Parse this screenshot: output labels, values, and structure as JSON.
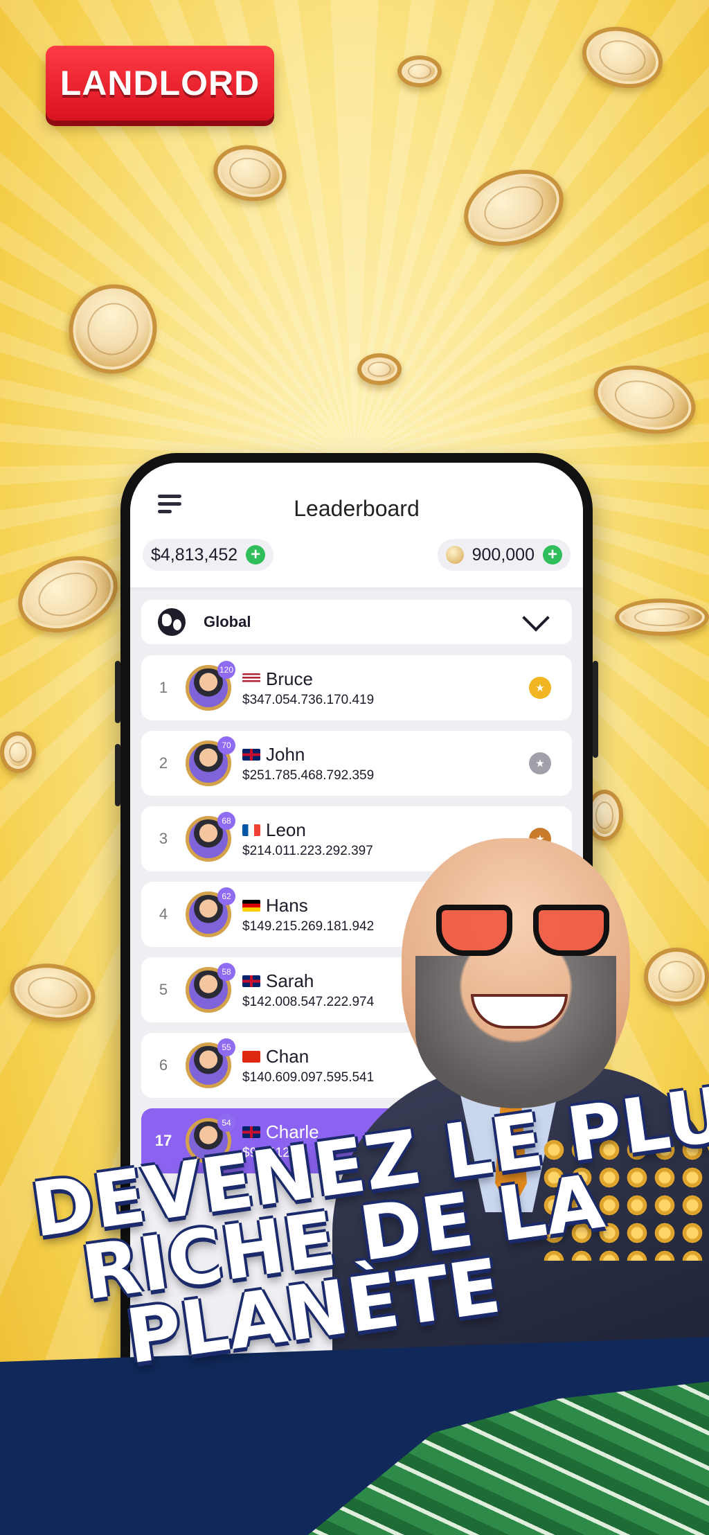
{
  "logo": {
    "text": "LANDLORD"
  },
  "leaderboard": {
    "title": "Leaderboard",
    "cash": "$4,813,452",
    "coins": "900,000",
    "filter": "Global",
    "rows": [
      {
        "rank": "1",
        "level": "120",
        "flag": "us",
        "name": "Bruce",
        "money": "$347.054.736.170.419",
        "medal": "gold"
      },
      {
        "rank": "2",
        "level": "70",
        "flag": "gb",
        "name": "John",
        "money": "$251.785.468.792.359",
        "medal": "silver"
      },
      {
        "rank": "3",
        "level": "68",
        "flag": "fr",
        "name": "Leon",
        "money": "$214.011.223.292.397",
        "medal": "bronze"
      },
      {
        "rank": "4",
        "level": "62",
        "flag": "de",
        "name": "Hans",
        "money": "$149.215.269.181.942"
      },
      {
        "rank": "5",
        "level": "58",
        "flag": "gb",
        "name": "Sarah",
        "money": "$142.008.547.222.974"
      },
      {
        "rank": "6",
        "level": "55",
        "flag": "cn",
        "name": "Chan",
        "money": "$140.609.097.595.541"
      },
      {
        "rank": "17",
        "level": "54",
        "flag": "gb",
        "name": "Charle",
        "money": "$97.412.59",
        "current_user": true
      }
    ]
  },
  "slogan": {
    "line1": "DEVENEZ LE PLUS",
    "line2": "RICHE DE LA",
    "line3": "PLANÈTE"
  },
  "colors": {
    "accent": "#8b63f0",
    "brand": "#e01a26",
    "plus": "#2fbe5b"
  }
}
